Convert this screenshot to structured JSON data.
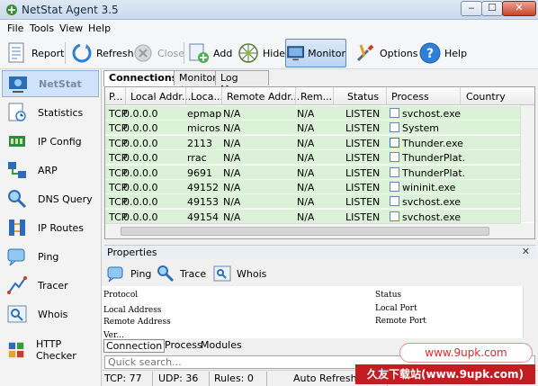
{
  "window": {
    "title": "NetStat Agent 3.5",
    "min": "‒",
    "max": "☐",
    "close": "✕"
  },
  "menu": [
    "File",
    "Tools",
    "View",
    "Help"
  ],
  "toolbar": {
    "report": "Report",
    "refresh": "Refresh",
    "close": "Close",
    "add": "Add",
    "hide": "Hide",
    "monitor": "Monitor",
    "options": "Options",
    "help": "Help"
  },
  "sidebar": {
    "items": [
      {
        "label": "NetStat",
        "icon": "netstat-icon"
      },
      {
        "label": "Statistics",
        "icon": "statistics-icon"
      },
      {
        "label": "IP Config",
        "icon": "ip-config-icon"
      },
      {
        "label": "ARP",
        "icon": "arp-icon"
      },
      {
        "label": "DNS Query",
        "icon": "dns-query-icon"
      },
      {
        "label": "IP Routes",
        "icon": "ip-routes-icon"
      },
      {
        "label": "Ping",
        "icon": "ping-icon"
      },
      {
        "label": "Tracer",
        "icon": "tracer-icon"
      },
      {
        "label": "Whois",
        "icon": "whois-icon"
      },
      {
        "label": "HTTP Checker",
        "icon": "http-checker-icon"
      }
    ]
  },
  "tabs": [
    "Connections",
    "Monitor",
    "Log Manager"
  ],
  "grid": {
    "columns": [
      "P...",
      "Local Addr...",
      "Loca...",
      "Remote Addr...",
      "Rem...",
      "Status",
      "Process",
      "Country"
    ],
    "rows": [
      [
        "TCP",
        "0.0.0.0",
        "epmap",
        "N/A",
        "N/A",
        "LISTEN",
        "svchost.exe"
      ],
      [
        "TCP",
        "0.0.0.0",
        "micros...",
        "N/A",
        "N/A",
        "LISTEN",
        "System"
      ],
      [
        "TCP",
        "0.0.0.0",
        "2113",
        "N/A",
        "N/A",
        "LISTEN",
        "Thunder.exe"
      ],
      [
        "TCP",
        "0.0.0.0",
        "rrac",
        "N/A",
        "N/A",
        "LISTEN",
        "ThunderPlat..."
      ],
      [
        "TCP",
        "0.0.0.0",
        "9691",
        "N/A",
        "N/A",
        "LISTEN",
        "ThunderPlat..."
      ],
      [
        "TCP",
        "0.0.0.0",
        "49152",
        "N/A",
        "N/A",
        "LISTEN",
        "wininit.exe"
      ],
      [
        "TCP",
        "0.0.0.0",
        "49153",
        "N/A",
        "N/A",
        "LISTEN",
        "svchost.exe"
      ],
      [
        "TCP",
        "0.0.0.0",
        "49154",
        "N/A",
        "N/A",
        "LISTEN",
        "svchost.exe"
      ]
    ],
    "row_color": "#dbf2d8"
  },
  "properties": {
    "title": "Properties",
    "close": "✕",
    "tools": {
      "ping": "Ping",
      "trace": "Trace",
      "whois": "Whois"
    },
    "fields": {
      "protocol": "Protocol",
      "status": "Status",
      "local_address": "Local Address",
      "local_port": "Local Port",
      "remote_address": "Remote Address",
      "remote_port": "Remote Port",
      "partial": "Ver..."
    },
    "subtabs": [
      "Connection",
      "Process",
      "Modules"
    ]
  },
  "search": {
    "placeholder": "Quick search..."
  },
  "status": {
    "tcp": "TCP: 77",
    "udp": "UDP: 36",
    "rules": "Rules: 0",
    "auto_refresh": "Auto Refresh: On"
  },
  "watermark": {
    "url": "www.9upk.com",
    "site": "久友下载站(www.9upk.com)"
  }
}
